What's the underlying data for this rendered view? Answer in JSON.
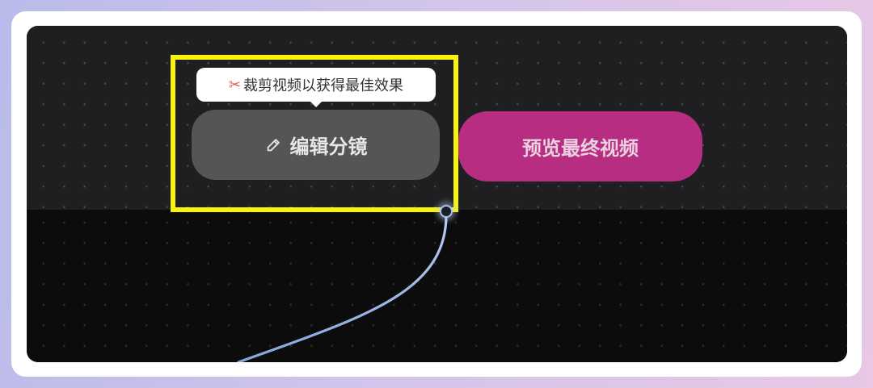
{
  "tooltip": {
    "icon": "scissors-icon",
    "text": "裁剪视频以获得最佳效果"
  },
  "edit_storyboard_button": {
    "icon": "pencil-icon",
    "label": "编辑分镜"
  },
  "preview_final_video_button": {
    "label": "预览最终视频"
  },
  "colors": {
    "highlight": "#f7f30a",
    "preview_accent": "#b62d81",
    "edit_button": "#555556",
    "connector": "#9db8ec"
  }
}
